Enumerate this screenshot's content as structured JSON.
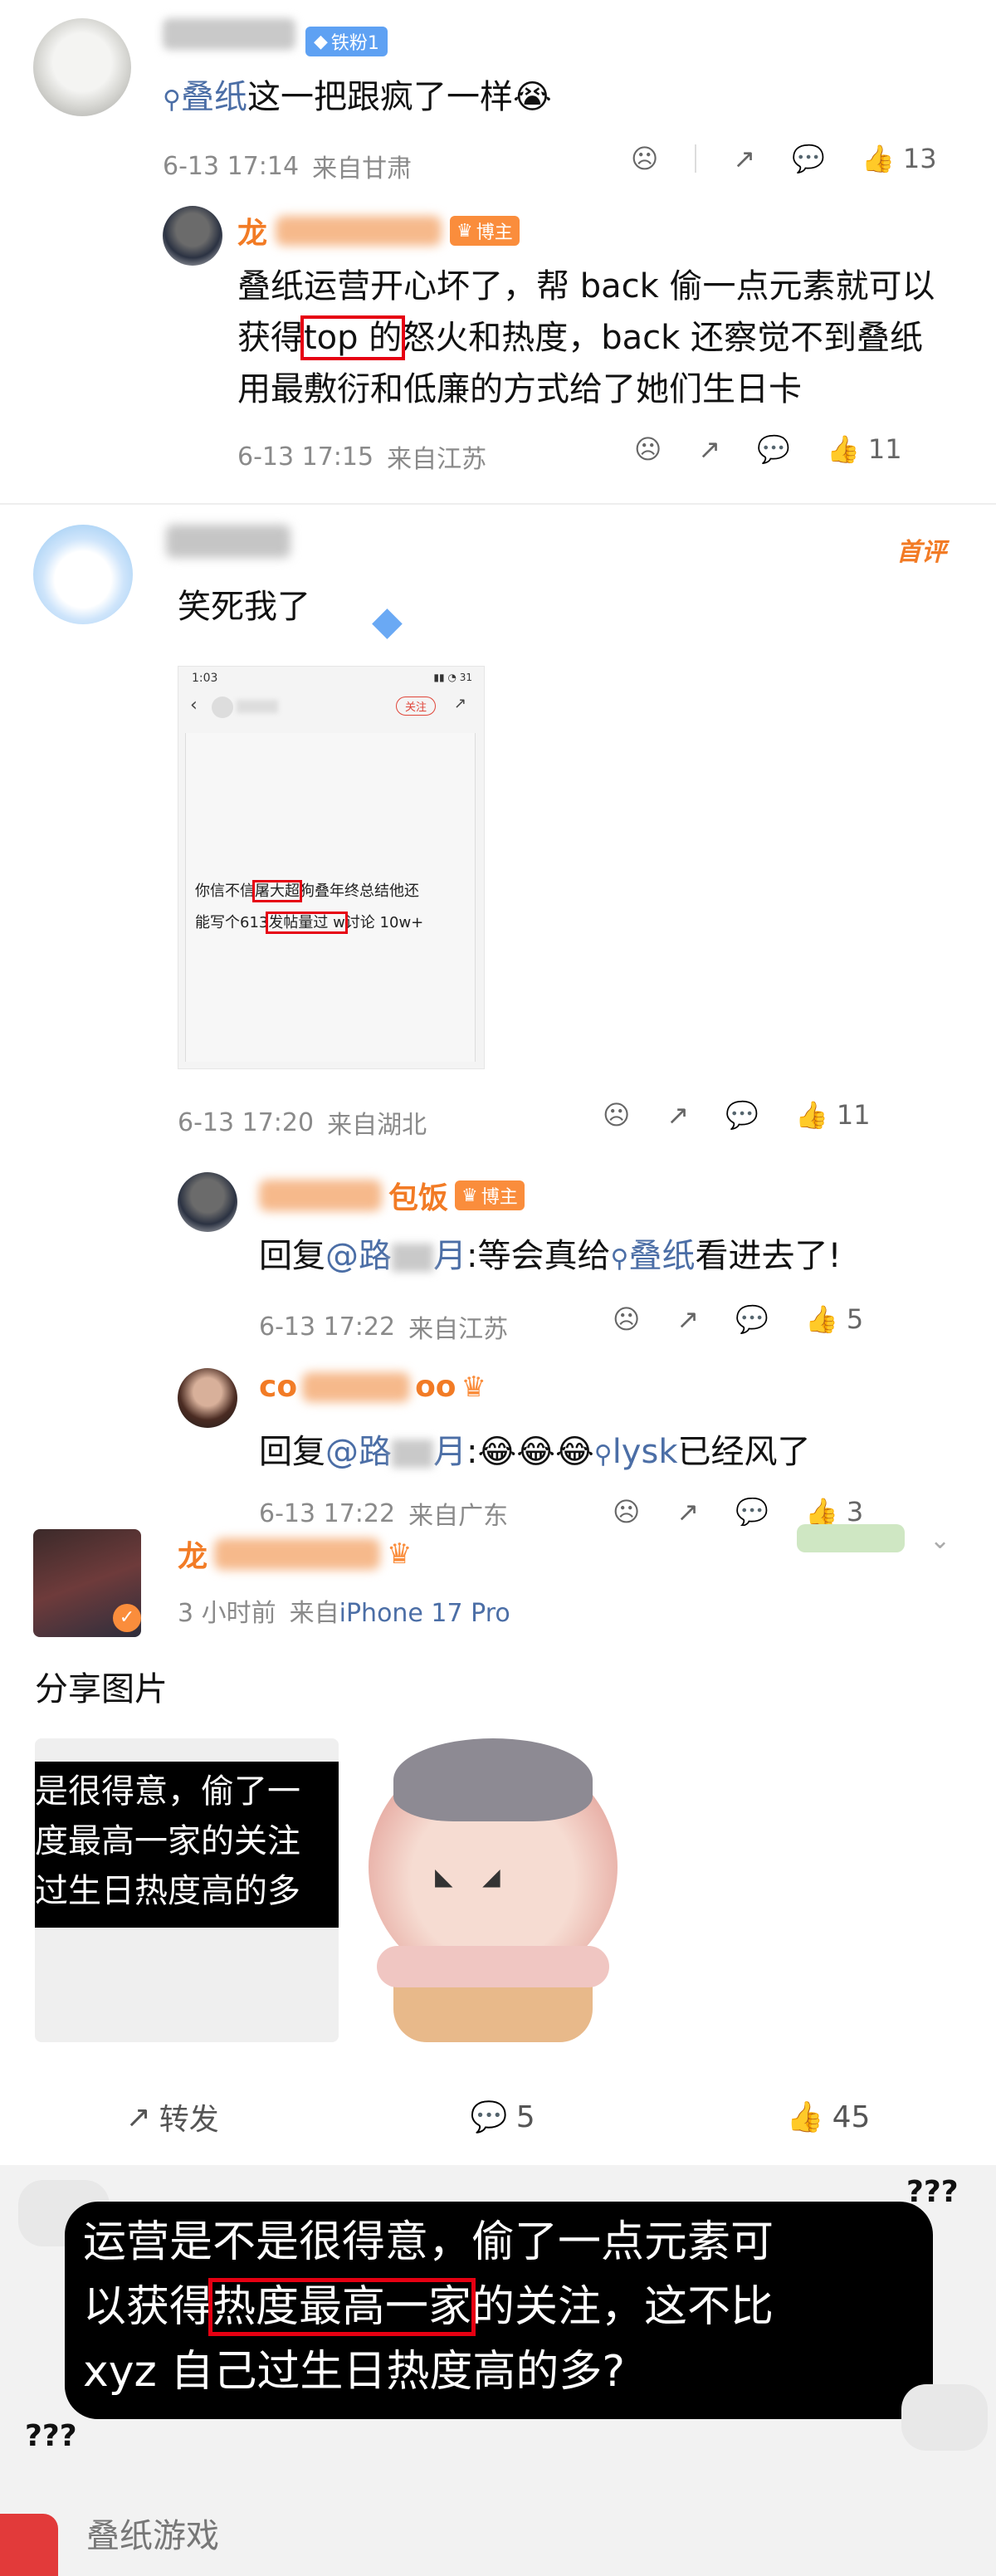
{
  "comment1": {
    "user_badge": "铁粉1",
    "search_link": "叠纸",
    "text_rest": "这一把跟疯了一样",
    "emoji": "😭",
    "time": "6-13 17:14",
    "location": "来自甘肃",
    "likes": "13"
  },
  "reply1": {
    "name_prefix": "龙",
    "badge": "博主",
    "line1": "叠纸运营开心坏了，帮 back 偷一点元素就可以",
    "line2_pre": "获得",
    "line2_box": "top 的",
    "line2_post": "怒火和热度，back 还察觉不到叠纸",
    "line3": "用最敷衍和低廉的方式给了她们生日卡",
    "time": "6-13 17:15",
    "location": "来自江苏",
    "likes": "11"
  },
  "comment2": {
    "first_tag": "首评",
    "text": "笑死我了",
    "shot_time": "1:03",
    "shot_follow": "关注",
    "shot_line1_pre": "你信不信",
    "shot_line1_box": "屠大超",
    "shot_line1_post": "狗叠年终总结他还",
    "shot_line2_pre": "能写个613",
    "shot_line2_box": "发帖量过 w",
    "shot_line2_post": "讨论 10w+",
    "time": "6-13 17:20",
    "location": "来自湖北",
    "likes": "11"
  },
  "reply2": {
    "name_suffix": "包饭",
    "badge": "博主",
    "reply_word": "回复",
    "mention": "@路",
    "mention_end": "月",
    "text_pre": ":等会真给",
    "search_link": "叠纸",
    "text_post": "看进去了!",
    "time": "6-13 17:22",
    "location": "来自江苏",
    "likes": "5"
  },
  "reply3": {
    "name_partial": "co",
    "name_end": "oo",
    "reply_word": "回复",
    "mention": "@路",
    "mention_end": "月",
    "emojis": ":😂😂😂",
    "search_link": "lysk",
    "text_post": "已经风了",
    "time": "6-13 17:22",
    "location": "来自广东",
    "likes": "3"
  },
  "post": {
    "name_prefix": "龙",
    "time": "3 小时前",
    "source_prefix": "来自",
    "source_device": "iPhone 17 Pro",
    "text": "分享图片",
    "img1_line1": "是很得意，偷了一",
    "img1_line2": "度最高一家的关注",
    "img1_line3": "过生日热度高的多",
    "repost_label": "转发",
    "comment_count": "5",
    "like_count": "45"
  },
  "caption": {
    "line1": "运营是不是很得意，偷了一点元素可",
    "line2_pre": "以获得",
    "line2_box": "热度最高一家",
    "line2_post": "的关注，这不比",
    "line3": "xyz 自己过生日热度高的多?",
    "marks_top": "???",
    "marks_bottom": "???"
  },
  "footer": {
    "text": "叠纸游戏"
  },
  "colors": {
    "link": "#4b6ea6",
    "orange": "#f27b25",
    "red_box": "#e60012"
  }
}
